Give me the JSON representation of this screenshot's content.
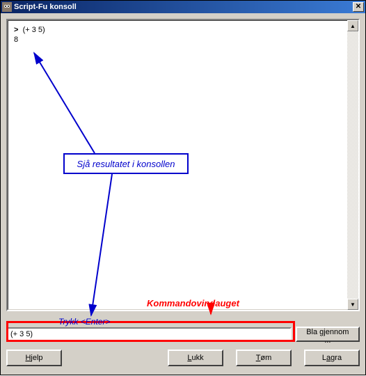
{
  "window": {
    "title": "Script-Fu konsoll"
  },
  "console": {
    "prompt_prefix": ">",
    "command": "(+ 3 5)",
    "result": "8"
  },
  "input": {
    "value": "(+ 3 5)",
    "browse_label": "Bla gjennom ..."
  },
  "buttons": {
    "help": "Hjelp",
    "close": "Lukk",
    "clear": "Tøm",
    "save": "Lagra"
  },
  "annotations": {
    "result_box": "Sjå resultatet i konsollen",
    "cmd_label": "Kommandovindauget",
    "enter_hint": "Trykk <Enter>"
  }
}
